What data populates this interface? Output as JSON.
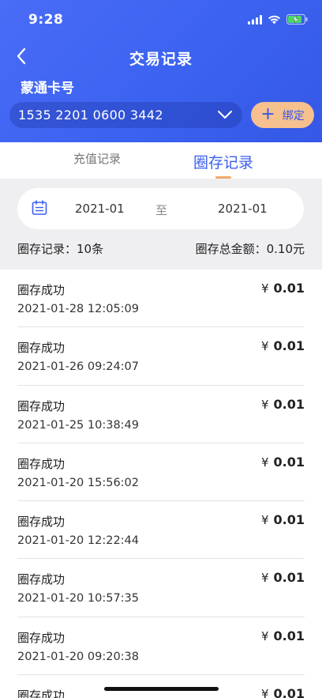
{
  "status_bar": {
    "time": "9:28"
  },
  "nav": {
    "title": "交易记录"
  },
  "card": {
    "label": "蒙通卡号",
    "number": "1535 2201 0600 3442",
    "bind_label": "绑定"
  },
  "tabs": [
    {
      "label": "充值记录",
      "active": false
    },
    {
      "label": "圈存记录",
      "active": true
    }
  ],
  "filter": {
    "date_from": "2021-01",
    "separator": "至",
    "date_to": "2021-01"
  },
  "summary": {
    "count_text": "圈存记录：10条",
    "total_text": "圈存总金额：0.10元"
  },
  "currency_symbol": "¥",
  "records": [
    {
      "title": "圈存成功",
      "time": "2021-01-28 12:05:09",
      "amount": "0.01"
    },
    {
      "title": "圈存成功",
      "time": "2021-01-26 09:24:07",
      "amount": "0.01"
    },
    {
      "title": "圈存成功",
      "time": "2021-01-25 10:38:49",
      "amount": "0.01"
    },
    {
      "title": "圈存成功",
      "time": "2021-01-20 15:56:02",
      "amount": "0.01"
    },
    {
      "title": "圈存成功",
      "time": "2021-01-20 12:22:44",
      "amount": "0.01"
    },
    {
      "title": "圈存成功",
      "time": "2021-01-20 10:57:35",
      "amount": "0.01"
    },
    {
      "title": "圈存成功",
      "time": "2021-01-20 09:20:38",
      "amount": "0.01"
    },
    {
      "title": "圈存成功",
      "time": "",
      "amount": "0.01"
    }
  ],
  "colors": {
    "header": "#3b62f0",
    "accent": "#3a5ff0",
    "bind_button": "#f6c08f",
    "tab_indicator": "#f6a86a"
  },
  "icons": {
    "back": "chevron-left-icon",
    "dropdown": "chevron-down-icon",
    "calendar": "calendar-icon",
    "signal": "signal-icon",
    "wifi": "wifi-icon",
    "battery": "battery-charging-icon"
  }
}
